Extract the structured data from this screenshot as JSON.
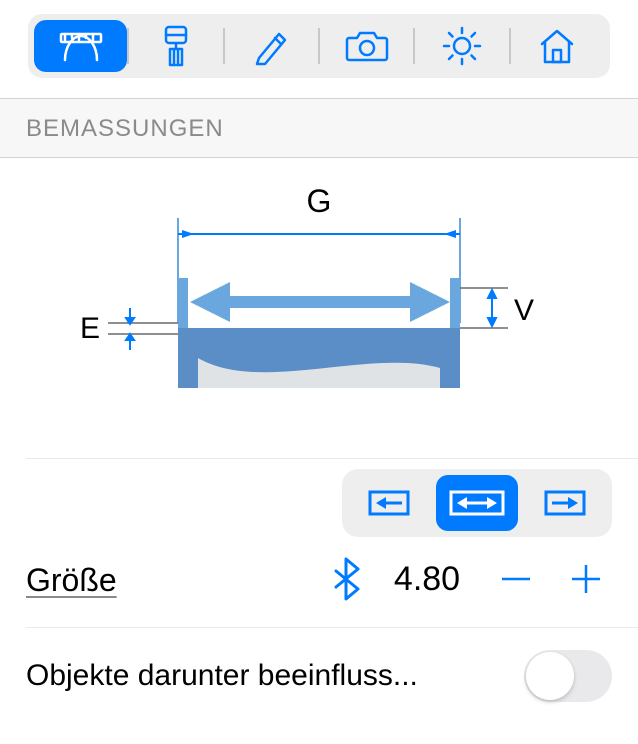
{
  "toolbar": {
    "items": [
      {
        "name": "dimensions-tool",
        "selected": true,
        "icon": "measure"
      },
      {
        "name": "style-tool",
        "selected": false,
        "icon": "brush"
      },
      {
        "name": "edit-tool",
        "selected": false,
        "icon": "pencil"
      },
      {
        "name": "camera-tool",
        "selected": false,
        "icon": "camera"
      },
      {
        "name": "light-tool",
        "selected": false,
        "icon": "sun"
      },
      {
        "name": "home-tool",
        "selected": false,
        "icon": "house"
      }
    ]
  },
  "section": {
    "title": "BEMASSUNGEN"
  },
  "diagram_labels": {
    "G": "G",
    "E": "E",
    "V": "V"
  },
  "size": {
    "label": "Größe",
    "value": "4.80",
    "alignment_selected": 1
  },
  "affect": {
    "label": "Objekte darunter beeinfluss...",
    "enabled": false
  }
}
